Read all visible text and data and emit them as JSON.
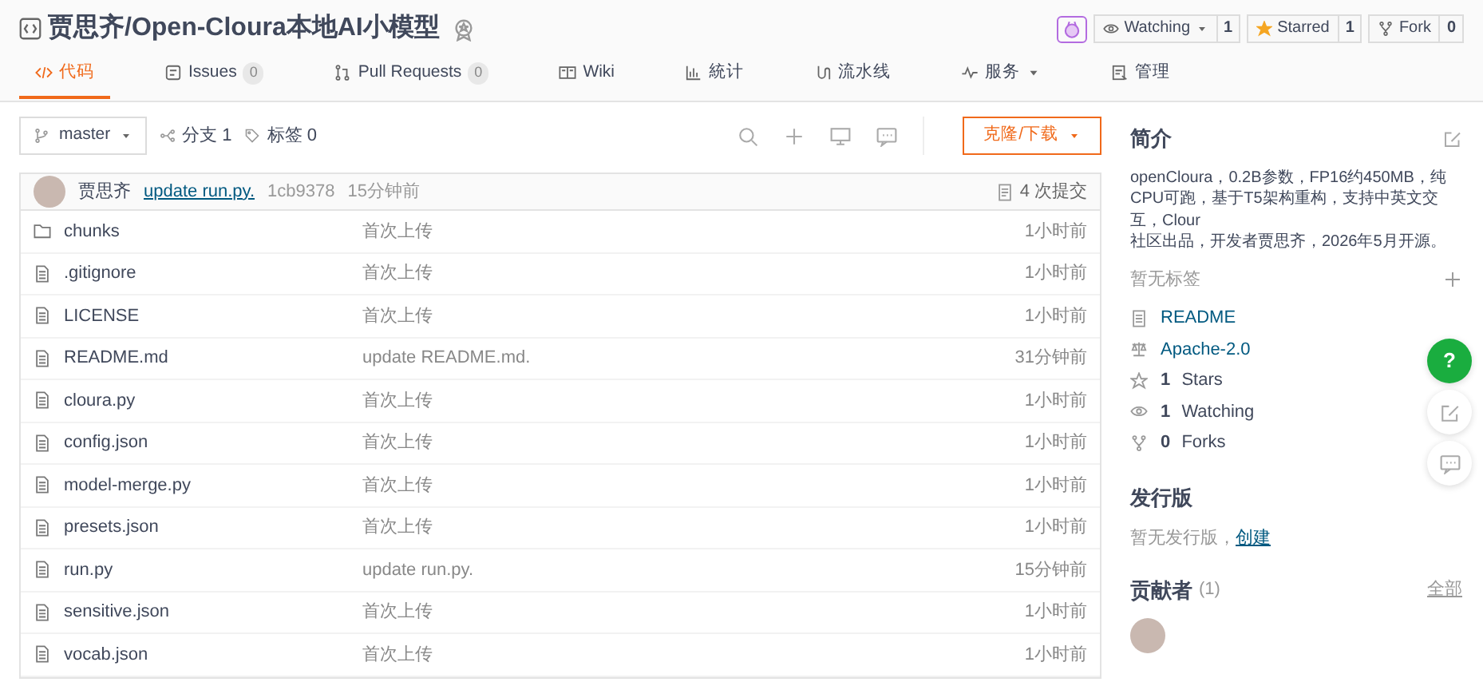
{
  "repo": {
    "title": "贾思齐/Open-Cloura本地AI小模型"
  },
  "header_actions": [
    {
      "kind": "watch",
      "label": "Watching",
      "count": "1"
    },
    {
      "kind": "star",
      "label": "Starred",
      "count": "1"
    },
    {
      "kind": "fork",
      "label": "Fork",
      "count": "0"
    }
  ],
  "tabs": [
    {
      "kind": "code",
      "label": "代码",
      "selected": true
    },
    {
      "kind": "issues",
      "label": "Issues",
      "count": "0",
      "selected": false
    },
    {
      "kind": "pr",
      "label": "Pull Requests",
      "count": "0",
      "selected": false
    },
    {
      "kind": "wiki",
      "label": "Wiki",
      "selected": false
    },
    {
      "kind": "stats",
      "label": "統计",
      "selected": false
    },
    {
      "kind": "pipeline",
      "label": "流水线",
      "selected": false
    },
    {
      "kind": "service",
      "label": "服务",
      "dropdown": true,
      "selected": false
    },
    {
      "kind": "manage",
      "label": "管理",
      "selected": false
    }
  ],
  "toolbar": {
    "branch": "master",
    "branches": "分支 1",
    "tags": "标签 0",
    "clone_button": "克隆/下载"
  },
  "commit": {
    "author": "贾思齐",
    "message": "update run.py.",
    "hash": "1cb9378",
    "time": "15分钟前",
    "count": "4 次提交"
  },
  "files": [
    {
      "kind": "folder",
      "name": "chunks",
      "message": "首次上传",
      "time": "1小时前"
    },
    {
      "kind": "file",
      "name": ".gitignore",
      "message": "首次上传",
      "time": "1小时前"
    },
    {
      "kind": "file",
      "name": "LICENSE",
      "message": "首次上传",
      "time": "1小时前"
    },
    {
      "kind": "file",
      "name": "README.md",
      "message": "update README.md.",
      "time": "31分钟前"
    },
    {
      "kind": "file",
      "name": "cloura.py",
      "message": "首次上传",
      "time": "1小时前"
    },
    {
      "kind": "file",
      "name": "config.json",
      "message": "首次上传",
      "time": "1小时前"
    },
    {
      "kind": "file",
      "name": "model-merge.py",
      "message": "首次上传",
      "time": "1小时前"
    },
    {
      "kind": "file",
      "name": "presets.json",
      "message": "首次上传",
      "time": "1小时前"
    },
    {
      "kind": "file",
      "name": "run.py",
      "message": "update run.py.",
      "time": "15分钟前"
    },
    {
      "kind": "file",
      "name": "sensitive.json",
      "message": "首次上传",
      "time": "1小时前"
    },
    {
      "kind": "file",
      "name": "vocab.json",
      "message": "首次上传",
      "time": "1小时前"
    }
  ],
  "sidebar": {
    "intro_title": "简介",
    "description_lines": [
      "openCloura，0.2B参数，FP16约450MB，纯CPU可跑，基于T5架构重构，支持中英文交互，Clour",
      "社区出品，开发者贾思齐，2026年5月开源。"
    ],
    "no_tags": "暂无标签",
    "links": [
      {
        "kind": "readme",
        "label": "README"
      },
      {
        "kind": "license",
        "label": "Apache-2.0"
      },
      {
        "kind": "stars",
        "count": "1",
        "label": "Stars"
      },
      {
        "kind": "watching",
        "count": "1",
        "label": "Watching"
      },
      {
        "kind": "forks",
        "count": "0",
        "label": "Forks"
      }
    ],
    "releases_title": "发行版",
    "no_releases": "暂无发行版，",
    "create_link": "创建",
    "contributors_title": "贡献者",
    "contributors_count": "(1)",
    "all_link": "全部"
  },
  "floating": [
    {
      "kind": "help",
      "label": "?"
    },
    {
      "kind": "edit"
    },
    {
      "kind": "chat"
    }
  ]
}
